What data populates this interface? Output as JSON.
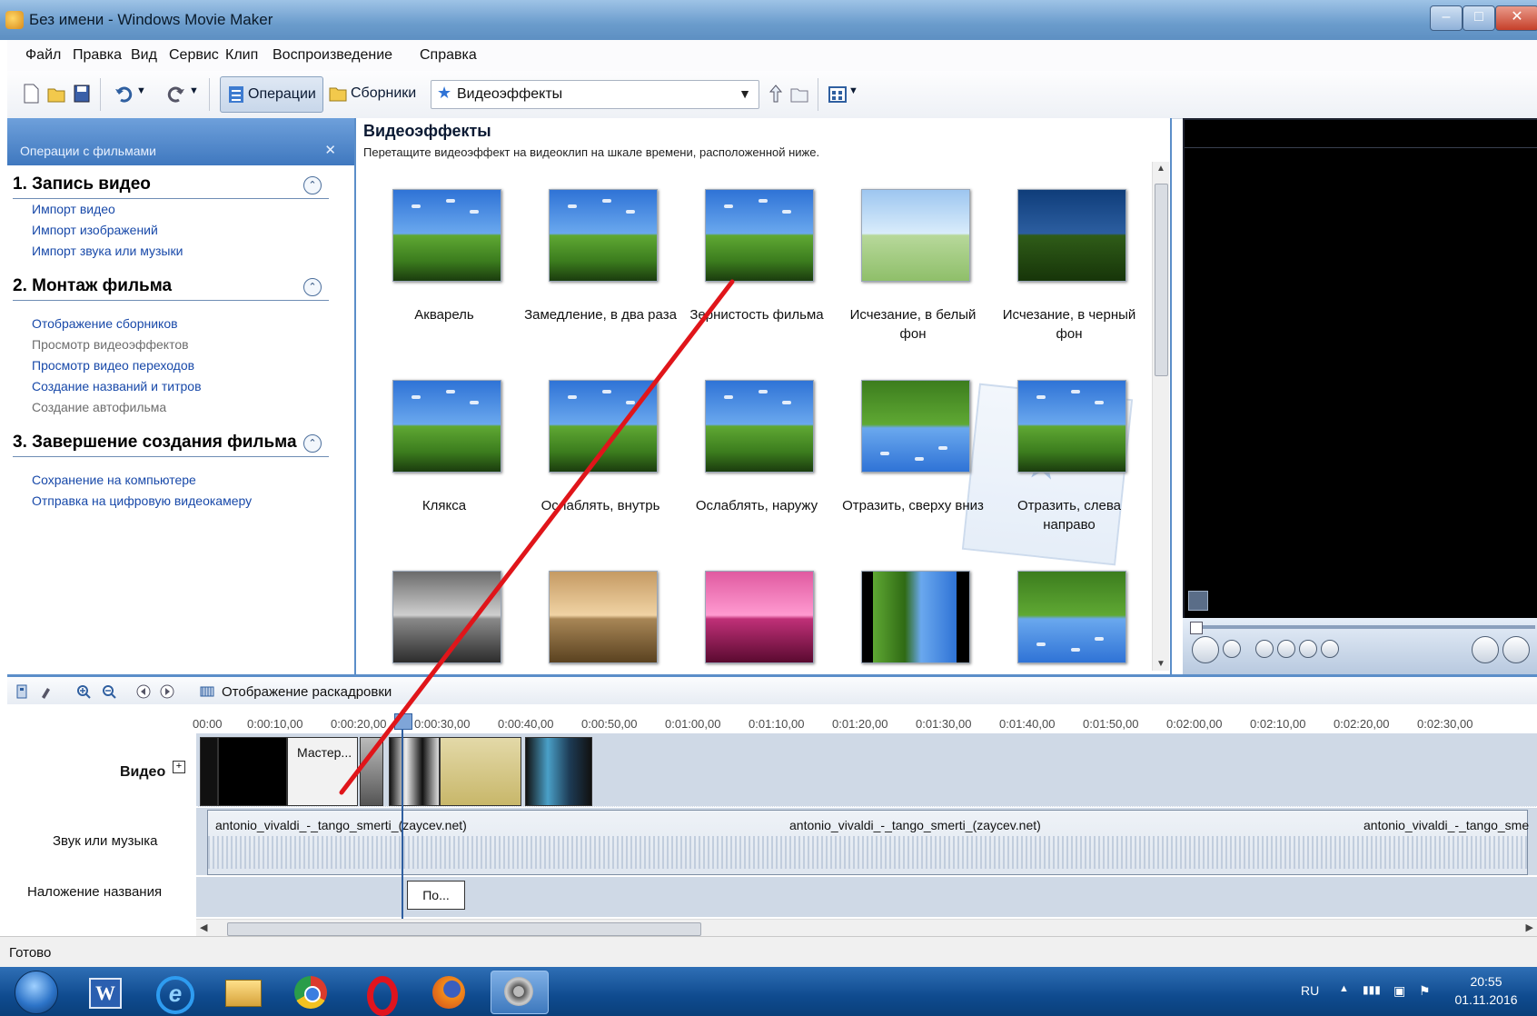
{
  "window": {
    "title": "Без имени - Windows Movie Maker"
  },
  "menu": [
    "Файл",
    "Правка",
    "Вид",
    "Сервис",
    "Клип",
    "Воспроизведение",
    "Справка"
  ],
  "toolbar": {
    "operations_label": "Операции",
    "collections_label": "Сборники",
    "combo_value": "Видеоэффекты",
    "icons": [
      "new-icon",
      "open-icon",
      "save-icon",
      "undo-icon",
      "redo-icon",
      "up-folder-icon",
      "new-folder-icon",
      "view-icon"
    ]
  },
  "tasks": {
    "header": "Операции с фильмами",
    "sections": [
      {
        "title": "1. Запись видео",
        "items": [
          {
            "label": "Импорт видео",
            "enabled": true
          },
          {
            "label": "Импорт изображений",
            "enabled": true
          },
          {
            "label": "Импорт звука или музыки",
            "enabled": true
          }
        ]
      },
      {
        "title": "2. Монтаж фильма",
        "items": [
          {
            "label": "Отображение сборников",
            "enabled": true
          },
          {
            "label": "Просмотр видеоэффектов",
            "enabled": false
          },
          {
            "label": "Просмотр видео переходов",
            "enabled": true
          },
          {
            "label": "Создание названий и титров",
            "enabled": true
          },
          {
            "label": "Создание автофильма",
            "enabled": false
          }
        ]
      },
      {
        "title": "3. Завершение создания фильма",
        "items": [
          {
            "label": "Сохранение на компьютере",
            "enabled": true
          },
          {
            "label": "Отправка на цифровую видеокамеру",
            "enabled": true
          }
        ]
      }
    ]
  },
  "effects_pane": {
    "title": "Видеоэффекты",
    "subtitle": "Перетащите видеоэффект на видеоклип на шкале времени, расположенной ниже.",
    "effects": [
      {
        "label": "Акварель",
        "style": "blue"
      },
      {
        "label": "Замедление, в два раза",
        "style": "blue"
      },
      {
        "label": "Зернистость фильма",
        "style": "blue"
      },
      {
        "label": "Исчезание, в белый фон",
        "style": "white"
      },
      {
        "label": "Исчезание, в черный фон",
        "style": "dark"
      },
      {
        "label": "Клякса",
        "style": "blue"
      },
      {
        "label": "Ослаблять, внутрь",
        "style": "blue"
      },
      {
        "label": "Ослаблять, наружу",
        "style": "blue"
      },
      {
        "label": "Отразить, сверху вниз",
        "style": "flipv"
      },
      {
        "label": "Отразить, слева направо",
        "style": "blue"
      },
      {
        "label": "",
        "style": "gray"
      },
      {
        "label": "",
        "style": "sepia"
      },
      {
        "label": "",
        "style": "pink"
      },
      {
        "label": "",
        "style": "mirror"
      },
      {
        "label": "",
        "style": "flipv"
      }
    ]
  },
  "timeline": {
    "view_label": "Отображение раскадровки",
    "ruler": [
      "00:00",
      "0:00:10,00",
      "0:00:20,00",
      "0:00:30,00",
      "0:00:40,00",
      "0:00:50,00",
      "0:01:00,00",
      "0:01:10,00",
      "0:01:20,00",
      "0:01:30,00",
      "0:01:40,00",
      "0:01:50,00",
      "0:02:00,00",
      "0:02:10,00",
      "0:02:20,00",
      "0:02:30,00"
    ],
    "track_video": "Видео",
    "track_audio": "Звук или музыка",
    "track_title": "Наложение названия",
    "video_clip_text": "Мастер...",
    "audio_clips": [
      "antonio_vivaldi_-_tango_smerti_(zaycev.net)",
      "antonio_vivaldi_-_tango_smerti_(zaycev.net)",
      "antonio_vivaldi_-_tango_sme"
    ],
    "title_clip": "По..."
  },
  "status": {
    "text": "Готово"
  },
  "taskbar": {
    "lang": "RU",
    "time": "20:55",
    "date": "01.11.2016",
    "apps": [
      "word-icon",
      "ie-icon",
      "explorer-icon",
      "chrome-icon",
      "opera-icon",
      "firefox-icon",
      "moviemaker-icon"
    ]
  }
}
